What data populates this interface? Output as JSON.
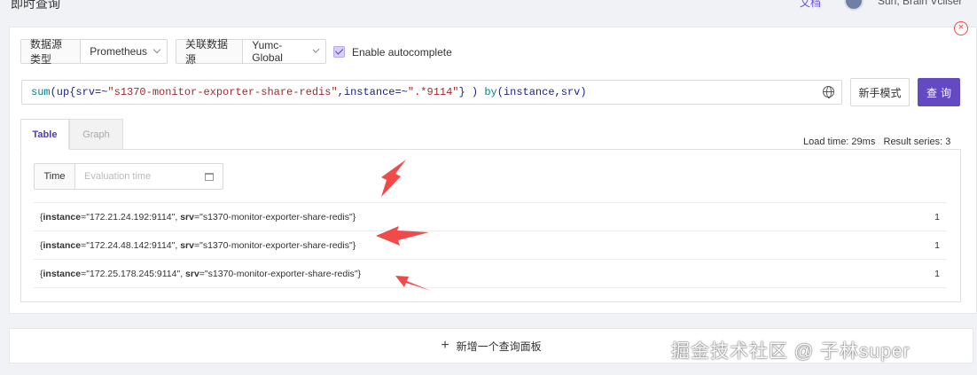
{
  "header": {
    "title": "即时查询",
    "help_link": "文档",
    "user_name": "Sun, Brain Vcliser"
  },
  "controls": {
    "datasource_type_label": "数据源类型",
    "datasource_type_value": "Prometheus",
    "related_datasource_label": "关联数据源",
    "related_datasource_value": "Yumc-Global",
    "autocomplete_label": "Enable autocomplete",
    "autocomplete_checked": true
  },
  "query": {
    "parts": [
      {
        "t": "sum",
        "k": "fn"
      },
      {
        "t": "(up{srv=~",
        "k": "txt"
      },
      {
        "t": "\"s1370-monitor-exporter-share-redis\"",
        "k": "str"
      },
      {
        "t": ",instance=~",
        "k": "txt"
      },
      {
        "t": "\".*9114\"",
        "k": "str"
      },
      {
        "t": "} ) ",
        "k": "txt"
      },
      {
        "t": "by",
        "k": "fn"
      },
      {
        "t": "(instance,srv)",
        "k": "txt"
      }
    ],
    "novice_button": "新手模式",
    "query_button": "查询"
  },
  "tabs": [
    {
      "label": "Table",
      "active": true
    },
    {
      "label": "Graph",
      "active": false
    }
  ],
  "stats": {
    "load_time": "Load time: 29ms",
    "result_series": "Result series: 3"
  },
  "time": {
    "label": "Time",
    "placeholder": "Evaluation time"
  },
  "results": [
    {
      "instance": "172.21.24.192:9114",
      "srv": "s1370-monitor-exporter-share-redis",
      "value": "1"
    },
    {
      "instance": "172.24.48.142:9114",
      "srv": "s1370-monitor-exporter-share-redis",
      "value": "1"
    },
    {
      "instance": "172.25.178.245:9114",
      "srv": "s1370-monitor-exporter-share-redis",
      "value": "1"
    }
  ],
  "footer": {
    "add_panel_label": "新增一个查询面板"
  },
  "watermark": "掘金技术社区 @ 子林super",
  "colors": {
    "accent": "#6349c2",
    "annotation_arrow": "#f04a4a"
  }
}
